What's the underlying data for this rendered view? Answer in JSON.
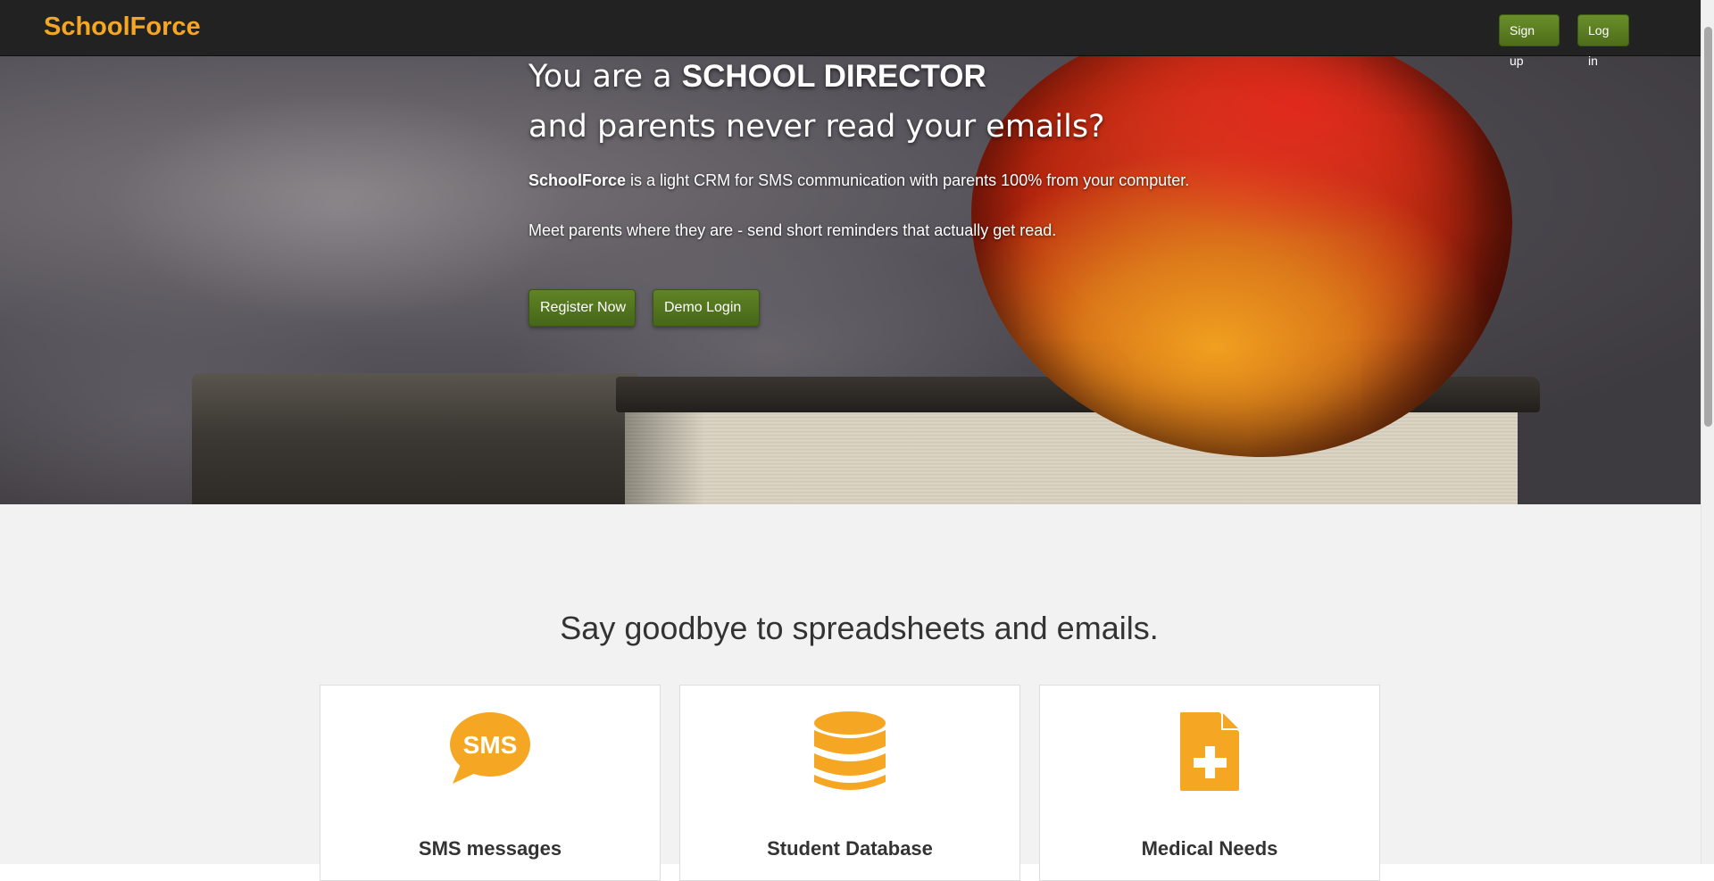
{
  "nav": {
    "brand": "SchoolForce",
    "signup_label": "Sign up",
    "login_label": "Log in"
  },
  "hero": {
    "headline_prefix": "You are a ",
    "headline_emphasis": "SCHOOL DIRECTOR",
    "headline_line2": "and parents never read your emails?",
    "tagline_brand": "SchoolForce",
    "tagline_rest": " is a light CRM for SMS communication with parents 100% from your computer.",
    "tagline2": "Meet parents where they are - send short reminders that actually get read.",
    "register_label": "Register Now",
    "demo_label": "Demo Login"
  },
  "features": {
    "title": "Say goodbye to spreadsheets and emails.",
    "cards": [
      {
        "title": "SMS messages",
        "icon": "sms-bubble-icon",
        "icon_text": "SMS"
      },
      {
        "title": "Student Database",
        "icon": "database-icon"
      },
      {
        "title": "Medical Needs",
        "icon": "medical-document-icon"
      }
    ]
  },
  "colors": {
    "brand": "#f5a623",
    "navbar": "#222222",
    "button_green": "#5a7d22",
    "icon_orange": "#f5a623",
    "features_bg": "#f2f2f2"
  }
}
